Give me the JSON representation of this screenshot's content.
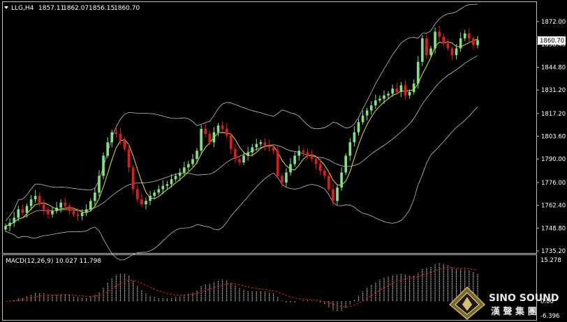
{
  "header": {
    "symbol_label": "LLG,H4",
    "ohlc": [
      "1857.11",
      "1862.07",
      "1856.15",
      "1860.70"
    ]
  },
  "price_axis": {
    "ticks": [
      "1872.00",
      "1858.40",
      "1844.80",
      "1831.20",
      "1817.20",
      "1803.60",
      "1790.00",
      "1776.00",
      "1762.40",
      "1748.80",
      "1735.20"
    ],
    "current_price": "1860.70"
  },
  "macd_panel": {
    "label": "MACD(12,26,9) 10.027 11.798",
    "ticks": [
      "15.278",
      "0.00",
      "-6.396"
    ]
  },
  "logo": {
    "name": "SINO SOUND",
    "chinese": "漢 聲 集 團",
    "icon": "diamond-logo-icon"
  },
  "colors": {
    "background": "#000000",
    "grid_border": "#c0c0c0",
    "bull_candle": "#7fe57f",
    "bear_candle": "#e81919",
    "bollinger": "#bfbfbf",
    "moving_average": "#f0e000",
    "macd_histogram": "#c8c8c8",
    "macd_signal": "#e81919",
    "text": "#ffffff"
  },
  "chart_data": {
    "type": "candlestick",
    "timeframe": "H4",
    "ylim": [
      1735.2,
      1878.0
    ],
    "candles_approx_close": [
      1750,
      1752,
      1755,
      1760,
      1758,
      1762,
      1766,
      1768,
      1763,
      1760,
      1757,
      1759,
      1761,
      1764,
      1762,
      1759,
      1757,
      1756,
      1758,
      1760,
      1765,
      1770,
      1780,
      1792,
      1800,
      1806,
      1805,
      1801,
      1796,
      1785,
      1772,
      1766,
      1763,
      1765,
      1768,
      1770,
      1772,
      1774,
      1775,
      1778,
      1780,
      1782,
      1785,
      1787,
      1790,
      1795,
      1808,
      1805,
      1800,
      1806,
      1810,
      1808,
      1804,
      1796,
      1790,
      1788,
      1792,
      1794,
      1797,
      1799,
      1800,
      1798,
      1797,
      1795,
      1780,
      1776,
      1782,
      1787,
      1792,
      1795,
      1794,
      1792,
      1790,
      1787,
      1783,
      1780,
      1772,
      1765,
      1773,
      1782,
      1792,
      1800,
      1806,
      1812,
      1816,
      1819,
      1822,
      1825,
      1826,
      1828,
      1829,
      1832,
      1830,
      1834,
      1828,
      1830,
      1835,
      1848,
      1862,
      1852,
      1856,
      1866,
      1863,
      1859,
      1856,
      1852,
      1856,
      1862,
      1865,
      1862,
      1858,
      1861
    ],
    "last_price": 1860.7,
    "indicator": {
      "name": "MACD(12,26,9)",
      "main_value": 10.027,
      "signal_value": 11.798,
      "ylim": [
        -6.396,
        15.278
      ]
    }
  }
}
